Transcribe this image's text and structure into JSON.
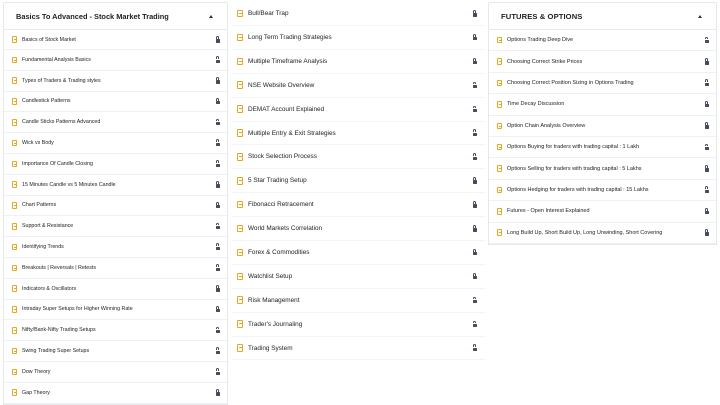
{
  "column1": {
    "title": "Basics To Advanced - Stock Market Trading",
    "items": [
      "Basics of Stock Market",
      "Fundamental Analysis Basics",
      "Types of Traders & Trading styles",
      "Candlestick Patterns",
      "Candle Sticks Patterns Advanced",
      "Wick vs Body",
      "Importance Of Candle Closing",
      "15 Minutes Candle vs 5 Minutes Candle",
      "Chart Patterns",
      "Support & Resistance",
      "Identifying Trends",
      "Breakouts | Reversals | Retests",
      "Indicators & Oscillators",
      "Intraday Super Setups for Higher Winning Rate",
      "Nifty/Bank-Nifty Trading Setups",
      "Swing Trading Super Setups",
      "Dow Theory",
      "Gap Theory"
    ]
  },
  "column2": {
    "items": [
      "Bull/Bear Trap",
      "Long Term Trading Strategies",
      "Multiple Timeframe Analysis",
      "NSE Website Overview",
      "DEMAT Account Explained",
      "Multiple Entry & Exit Strategies",
      "Stock Selection Process",
      "5 Star Trading Setup",
      "Fibonacci Retracement",
      "World Markets Correlation",
      "Forex & Commodities",
      "Watchlist Setup",
      "Risk Management",
      "Trader's Journaling",
      "Trading System"
    ]
  },
  "column3": {
    "title": "FUTURES & OPTIONS",
    "items": [
      "Options Trading Deep Dive",
      "Choosing Correct Strike Prices",
      "Choosing Correct Position Sizing in Options Trading",
      "Time Decay Discussion",
      "Option Chain Analysis Overview",
      "Options Buying for traders with trading capital : 1 Lakh",
      "Options Selling for traders with trading capital : 5 Lakhs",
      "Options Hedging for traders with trading capital : 15 Lakhs",
      "Futures - Open Interest Explained",
      "Long Build Up, Short Build Up, Long Unwinding, Short Covering"
    ]
  },
  "icons": {
    "item": "document-icon",
    "status": "lock-icon",
    "toggle": "caret-up-icon"
  },
  "colors": {
    "doc_icon": "#e7a821",
    "lock_icon": "#444b5a",
    "border": "#e6e8ec"
  }
}
